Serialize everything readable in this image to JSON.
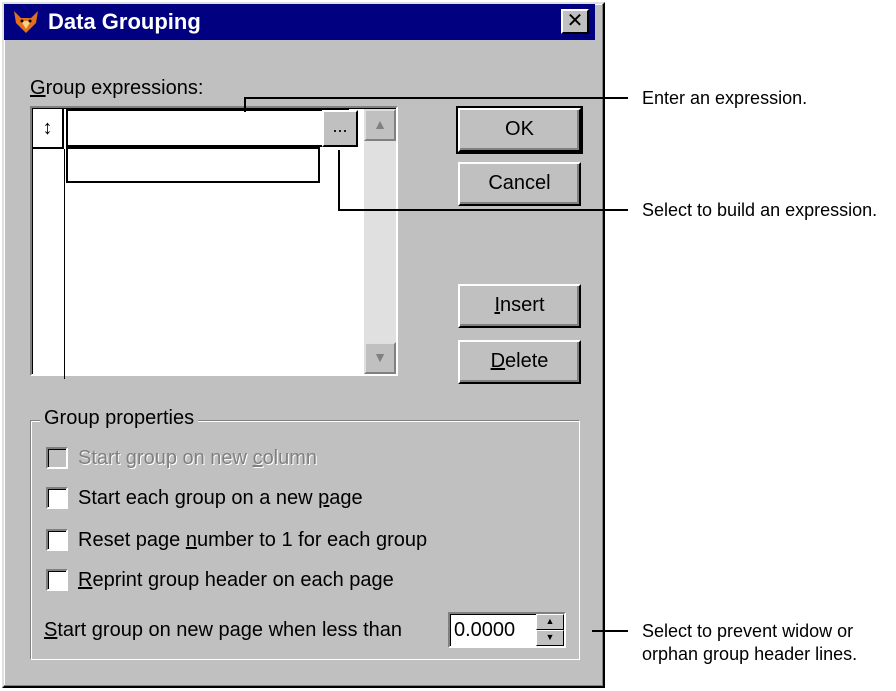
{
  "window": {
    "title": "Data Grouping",
    "close_glyph": "✕",
    "icon": "fox-app-icon"
  },
  "expressions": {
    "label_accel": "G",
    "label_rest": "roup expressions:",
    "row_handle_glyph": "↕",
    "expression_value": "",
    "builder_button_label": "..."
  },
  "buttons": {
    "ok": "OK",
    "cancel": "Cancel",
    "insert_accel": "I",
    "insert_rest": "nsert",
    "delete_accel": "D",
    "delete_rest": "elete"
  },
  "group_properties": {
    "legend": "Group properties",
    "option1_pre": "Start group on new ",
    "option1_accel": "c",
    "option1_post": "olumn",
    "option2_pre": "Start each group on a new ",
    "option2_accel": "p",
    "option2_post": "age",
    "option3_pre": "Reset page ",
    "option3_accel": "n",
    "option3_post": "umber to 1 for each group",
    "option4_accel": "R",
    "option4_post": "eprint group header on each page",
    "threshold_accel": "S",
    "threshold_rest": "tart group on new page when less than",
    "threshold_value": "0.0000"
  },
  "callouts": {
    "expression": "Enter an expression.",
    "builder": "Select to build an expression.",
    "widow_line1": "Select to prevent widow or",
    "widow_line2": "orphan group header lines."
  },
  "colors": {
    "title_bar": "#000080",
    "dialog_face": "#c0c0c0"
  }
}
